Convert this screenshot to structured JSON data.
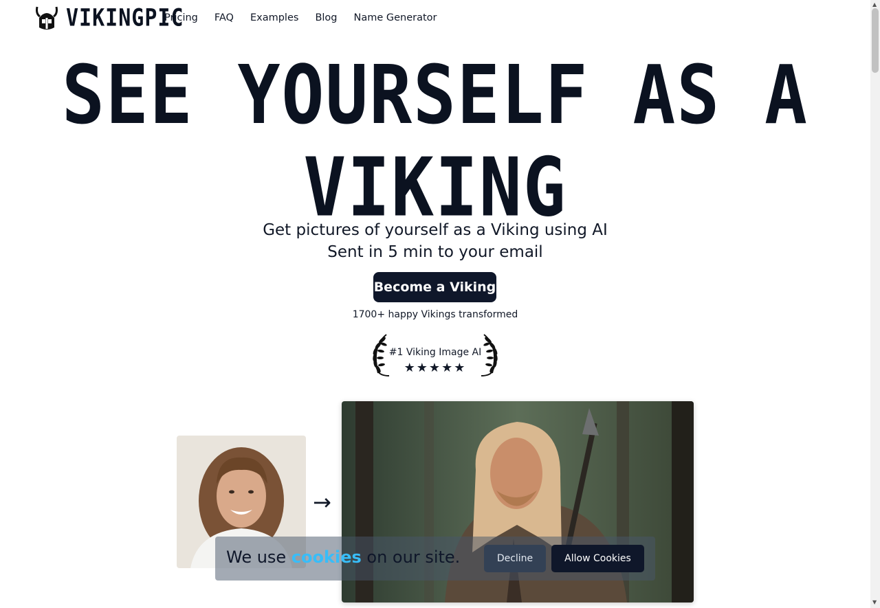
{
  "brand": {
    "name": "VIKINGPIC",
    "icon": "viking-helmet-icon"
  },
  "nav": {
    "items": [
      {
        "label": "Pricing"
      },
      {
        "label": "FAQ"
      },
      {
        "label": "Examples"
      },
      {
        "label": "Blog"
      },
      {
        "label": "Name Generator"
      }
    ]
  },
  "hero": {
    "title_line1": "SEE YOURSELF AS A",
    "title_line2": "VIKING",
    "subtitle_line1": "Get pictures of yourself as a Viking using AI",
    "subtitle_line2": "Sent in 5 min to your email",
    "cta_label": "Become a Viking",
    "social_proof": "1700+ happy Vikings transformed"
  },
  "award": {
    "text": "#1 Viking Image AI",
    "stars": "★★★★★",
    "rating": 5
  },
  "comparison": {
    "arrow": "→",
    "before_alt": "Photo of a smiling man with long curly hair",
    "after_alt": "AI image of the man as a Viking warrior with a spear"
  },
  "cookie_banner": {
    "text_before": "We use ",
    "link_text": "cookies",
    "text_after": " on our site.",
    "decline_label": "Decline",
    "allow_label": "Allow Cookies"
  },
  "colors": {
    "primary": "#0f172a",
    "link": "#38bdf8"
  }
}
